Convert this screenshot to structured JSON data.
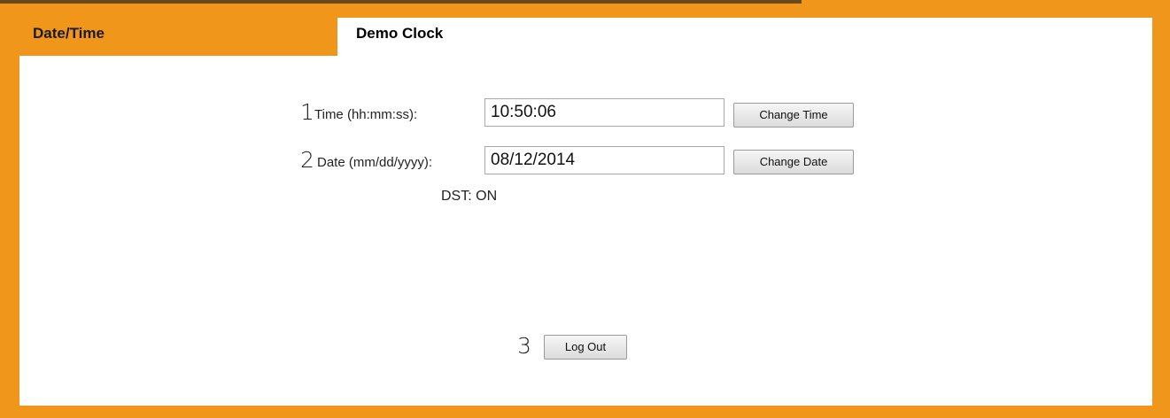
{
  "tabs": {
    "left_label": "Date/Time",
    "active_label": "Demo Clock"
  },
  "time_row": {
    "marker": "1",
    "label": "Time (hh:mm:ss):",
    "value": "10:50:06",
    "button": "Change Time"
  },
  "date_row": {
    "marker": "2",
    "label": "Date (mm/dd/yyyy):",
    "value": "08/12/2014",
    "button": "Change Date"
  },
  "dst": {
    "text": "DST: ON"
  },
  "logout": {
    "marker": "3",
    "button": "Log Out"
  },
  "colors": {
    "frame": "#f0961a",
    "panel": "#ffffff"
  }
}
